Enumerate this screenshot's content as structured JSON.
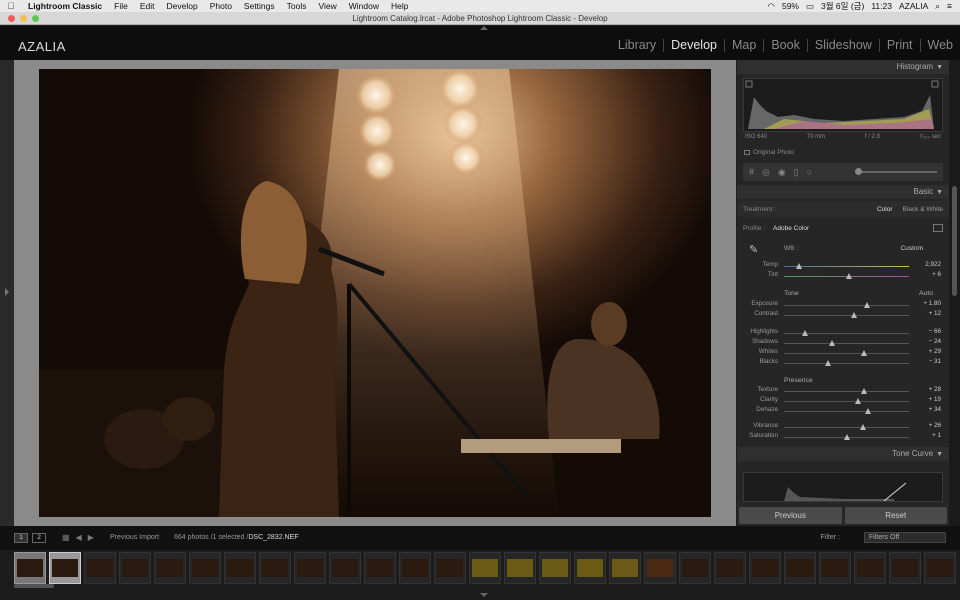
{
  "menubar": {
    "app_name": "Lightroom Classic",
    "items": [
      "File",
      "Edit",
      "Develop",
      "Photo",
      "Settings",
      "Tools",
      "View",
      "Window",
      "Help"
    ],
    "battery": "59%",
    "date": "3월 6일 (금)",
    "time": "11:23",
    "user": "AZALIA"
  },
  "window": {
    "title": "Lightroom Catalog.lrcat - Adobe Photoshop Lightroom Classic - Develop"
  },
  "identity_plate": "AZALIA",
  "modules": [
    "Library",
    "Develop",
    "Map",
    "Book",
    "Slideshow",
    "Print",
    "Web"
  ],
  "active_module": "Develop",
  "histogram": {
    "title": "Histogram",
    "iso": "ISO 640",
    "focal": "70 mm",
    "aperture": "f / 2.8",
    "shutter": "¹⁄₂₀₀ sec",
    "original_photo": "Original Photo"
  },
  "basic": {
    "title": "Basic",
    "treatment_label": "Treatment :",
    "treatment_color": "Color",
    "treatment_bw": "Black & White",
    "profile_label": "Profile :",
    "profile_value": "Adobe Color",
    "wb_label": "WB :",
    "wb_value": "Custom",
    "tone_label": "Tone",
    "auto_label": "Auto",
    "presence_label": "Presence",
    "sliders": [
      {
        "label": "Temp",
        "value": "2,922",
        "pos": 0.12
      },
      {
        "label": "Tint",
        "value": "+ 6",
        "pos": 0.52
      },
      {
        "label": "Exposure",
        "value": "+ 1.80",
        "pos": 0.66
      },
      {
        "label": "Contrast",
        "value": "+ 12",
        "pos": 0.56
      },
      {
        "label": "Highlights",
        "value": "− 66",
        "pos": 0.17
      },
      {
        "label": "Shadows",
        "value": "− 24",
        "pos": 0.38
      },
      {
        "label": "Whites",
        "value": "+ 29",
        "pos": 0.64
      },
      {
        "label": "Blacks",
        "value": "− 31",
        "pos": 0.35
      },
      {
        "label": "Texture",
        "value": "+ 28",
        "pos": 0.64
      },
      {
        "label": "Clarity",
        "value": "+ 19",
        "pos": 0.59
      },
      {
        "label": "Dehaze",
        "value": "+ 34",
        "pos": 0.67
      },
      {
        "label": "Vibrance",
        "value": "+ 26",
        "pos": 0.63
      },
      {
        "label": "Saturation",
        "value": "+ 1",
        "pos": 0.5
      }
    ]
  },
  "tone_curve": {
    "title": "Tone Curve"
  },
  "buttons": {
    "previous": "Previous",
    "reset": "Reset"
  },
  "filmstrip": {
    "page1": "1",
    "page2": "2",
    "source": "Previous Import",
    "count_text": "664 photos /1 selected /",
    "selected_file": "DSC_2832.NEF",
    "filter_label": "Filter :",
    "filter_value": "Filters Off"
  },
  "colors": {
    "accent_yellow": "#c9c24a",
    "panel_bg": "#262626",
    "photo_tint": "#9c6a40"
  }
}
